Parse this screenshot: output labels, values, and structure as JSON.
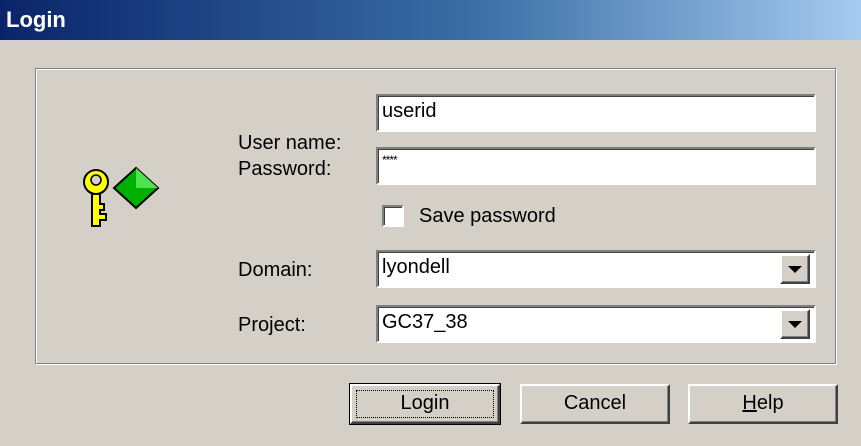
{
  "window": {
    "title": "Login"
  },
  "form": {
    "user_name_label": "User name:",
    "user_name_value": "userid",
    "password_label": "Password:",
    "password_value": "****",
    "save_password_label": "Save password",
    "save_password_checked": false,
    "domain_label": "Domain:",
    "domain_value": "lyondell",
    "project_label": "Project:",
    "project_value": "GC37_38"
  },
  "buttons": {
    "login": "Login",
    "cancel": "Cancel",
    "help_mnemonic": "H",
    "help_rest": "elp"
  },
  "icons": {
    "key": "key-icon",
    "dropdown": "dropdown-arrow-icon"
  },
  "colors": {
    "titlebar_start": "#0a246a",
    "titlebar_end": "#a6caf0",
    "dialog_bg": "#d4d0c8"
  }
}
